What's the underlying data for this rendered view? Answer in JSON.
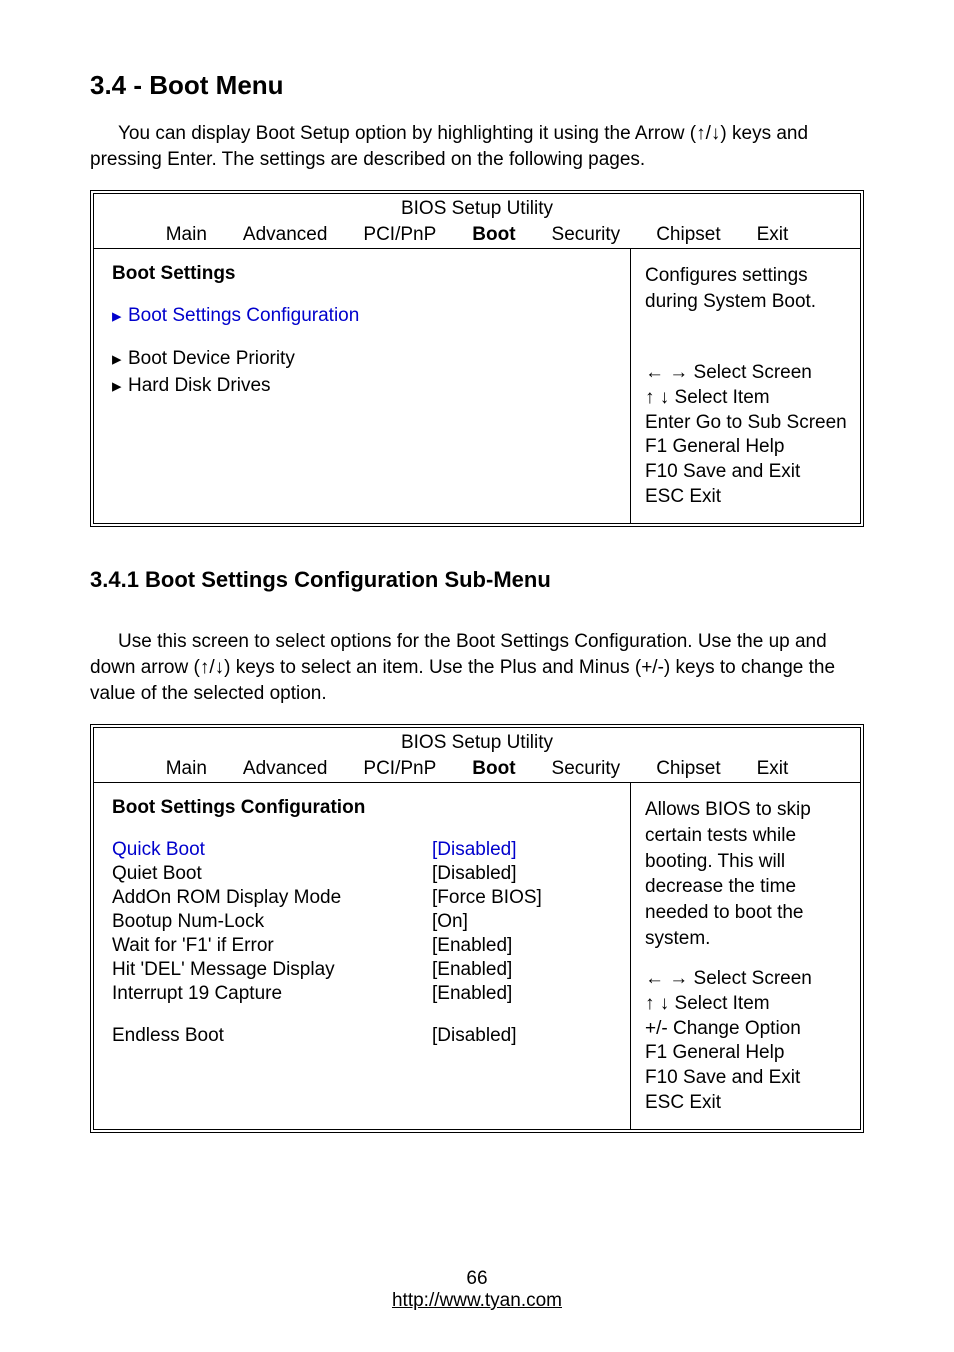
{
  "page": {
    "section_title": "3.4 - Boot Menu",
    "intro_text": "You can display Boot Setup option by highlighting it using the Arrow (↑/↓) keys and pressing Enter.  The settings are described on the following pages.",
    "sub_heading": "3.4.1 Boot Settings Configuration Sub-Menu",
    "sub_intro": "Use this screen to select options for the Boot Settings Configuration. Use the up and down arrow (↑/↓) keys to select an item. Use the Plus and Minus (+/-) keys to change the value of the selected option.",
    "footer_page": "66",
    "footer_url": "http://www.tyan.com"
  },
  "bios1": {
    "utility_title": "BIOS Setup Utility",
    "tabs": {
      "main": "Main",
      "advanced": "Advanced",
      "pcipnp": "PCI/PnP",
      "boot": "Boot",
      "security": "Security",
      "chipset": "Chipset",
      "exit": "Exit"
    },
    "left": {
      "heading": "Boot Settings",
      "items": {
        "bsc": "Boot Settings Configuration",
        "bdp": "Boot Device Priority",
        "hdd": "Hard Disk Drives"
      }
    },
    "right": {
      "upper": "Configures settings during System Boot.",
      "lines": {
        "l1": "← → Select Screen",
        "l2": "↑ ↓  Select Item",
        "l3": "Enter Go to Sub Screen",
        "l4": "F1      General Help",
        "l5": "F10   Save and Exit",
        "l6": "ESC  Exit"
      }
    }
  },
  "bios2": {
    "utility_title": "BIOS Setup Utility",
    "tabs": {
      "main": "Main",
      "advanced": "Advanced",
      "pcipnp": "PCI/PnP",
      "boot": "Boot",
      "security": "Security",
      "chipset": "Chipset",
      "exit": "Exit"
    },
    "left": {
      "heading": "Boot Settings Configuration",
      "rows": {
        "r1": {
          "label": "Quick Boot",
          "value": "[Disabled]"
        },
        "r2": {
          "label": "Quiet Boot",
          "value": "[Disabled]"
        },
        "r3": {
          "label": "AddOn ROM Display Mode",
          "value": "[Force BIOS]"
        },
        "r4": {
          "label": "Bootup Num-Lock",
          "value": "[On]"
        },
        "r5": {
          "label": "Wait for 'F1' if Error",
          "value": "[Enabled]"
        },
        "r6": {
          "label": "Hit 'DEL' Message Display",
          "value": "[Enabled]"
        },
        "r7": {
          "label": "Interrupt 19 Capture",
          "value": "[Enabled]"
        },
        "r8": {
          "label": "Endless Boot",
          "value": "[Disabled]"
        }
      }
    },
    "right": {
      "upper": "Allows BIOS to skip certain tests while booting.  This will decrease the time needed to boot the system.",
      "lines": {
        "l1": "← → Select Screen",
        "l2": "↑ ↓  Select Item",
        "l3": "+/-     Change Option",
        "l4": "F1      General Help",
        "l5": "F10   Save and Exit",
        "l6": "ESC  Exit"
      }
    }
  }
}
